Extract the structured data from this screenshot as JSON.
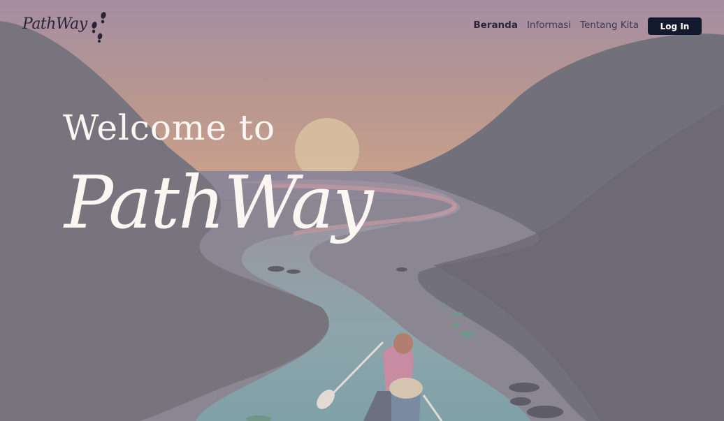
{
  "brand": {
    "logo_text": "PathWay"
  },
  "nav": {
    "links": [
      {
        "label": "Beranda",
        "active": true
      },
      {
        "label": "Informasi",
        "active": false
      },
      {
        "label": "Tentang Kita",
        "active": false
      }
    ],
    "login_label": "Log In"
  },
  "hero": {
    "welcome": "Welcome to",
    "brand": "PathWay"
  },
  "colors": {
    "sky_top": "#a58ea3",
    "sky_glow": "#c8a08e",
    "sun": "#d9c2a2",
    "hills": "#797680",
    "river": "#8ba9ad",
    "login_button": "#141a2e",
    "hero_text": "#fbf6f2"
  },
  "icons": [
    "footprints-icon",
    "canoe-illustration"
  ]
}
